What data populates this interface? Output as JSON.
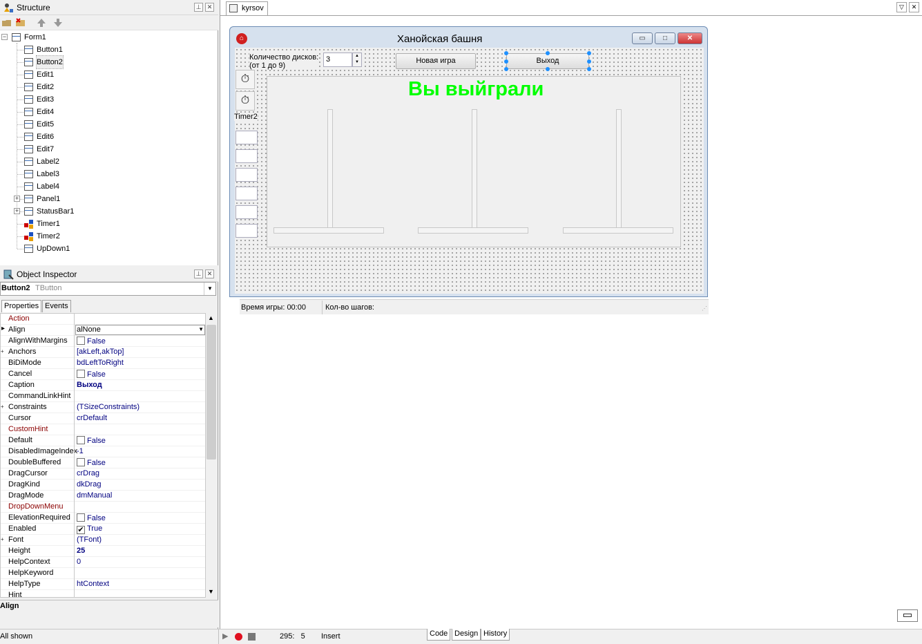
{
  "structure": {
    "title": "Structure",
    "root": "Form1",
    "items": [
      {
        "label": "Button1",
        "kind": "control"
      },
      {
        "label": "Button2",
        "kind": "control"
      },
      {
        "label": "Edit1",
        "kind": "control"
      },
      {
        "label": "Edit2",
        "kind": "control"
      },
      {
        "label": "Edit3",
        "kind": "control"
      },
      {
        "label": "Edit4",
        "kind": "control"
      },
      {
        "label": "Edit5",
        "kind": "control"
      },
      {
        "label": "Edit6",
        "kind": "control"
      },
      {
        "label": "Edit7",
        "kind": "control"
      },
      {
        "label": "Label2",
        "kind": "control"
      },
      {
        "label": "Label3",
        "kind": "control"
      },
      {
        "label": "Label4",
        "kind": "control"
      },
      {
        "label": "Panel1",
        "kind": "control",
        "expandable": true
      },
      {
        "label": "StatusBar1",
        "kind": "control",
        "expandable": true
      },
      {
        "label": "Timer1",
        "kind": "timer"
      },
      {
        "label": "Timer2",
        "kind": "timer"
      },
      {
        "label": "UpDown1",
        "kind": "control"
      }
    ]
  },
  "inspector": {
    "title": "Object Inspector",
    "selected_name": "Button2",
    "selected_type": "TButton",
    "tabs": [
      "Properties",
      "Events"
    ],
    "properties": [
      {
        "name": "Action",
        "value": "",
        "red": true
      },
      {
        "name": "Align",
        "value": "alNone",
        "selected": true
      },
      {
        "name": "AlignWithMargins",
        "value": "False",
        "check": "off"
      },
      {
        "name": "Anchors",
        "value": "[akLeft,akTop]",
        "plus": true
      },
      {
        "name": "BiDiMode",
        "value": "bdLeftToRight"
      },
      {
        "name": "Cancel",
        "value": "False",
        "check": "off"
      },
      {
        "name": "Caption",
        "value": "Выход",
        "bold": true
      },
      {
        "name": "CommandLinkHint",
        "value": ""
      },
      {
        "name": "Constraints",
        "value": "(TSizeConstraints)",
        "plus": true
      },
      {
        "name": "Cursor",
        "value": "crDefault"
      },
      {
        "name": "CustomHint",
        "value": "",
        "red": true
      },
      {
        "name": "Default",
        "value": "False",
        "check": "off"
      },
      {
        "name": "DisabledImageIndex",
        "value": "-1"
      },
      {
        "name": "DoubleBuffered",
        "value": "False",
        "check": "off"
      },
      {
        "name": "DragCursor",
        "value": "crDrag"
      },
      {
        "name": "DragKind",
        "value": "dkDrag"
      },
      {
        "name": "DragMode",
        "value": "dmManual"
      },
      {
        "name": "DropDownMenu",
        "value": "",
        "red": true
      },
      {
        "name": "ElevationRequired",
        "value": "False",
        "check": "off"
      },
      {
        "name": "Enabled",
        "value": "True",
        "check": "on"
      },
      {
        "name": "Font",
        "value": "(TFont)",
        "plus": true
      },
      {
        "name": "Height",
        "value": "25",
        "bold": true
      },
      {
        "name": "HelpContext",
        "value": "0"
      },
      {
        "name": "HelpKeyword",
        "value": ""
      },
      {
        "name": "HelpType",
        "value": "htContext"
      },
      {
        "name": "Hint",
        "value": ""
      }
    ],
    "description_title": "Align",
    "footer": "All shown"
  },
  "editor": {
    "tab_label": "kyrsov",
    "bottom_tabs": [
      "Code",
      "Design",
      "History"
    ],
    "position": "295:   5",
    "mode": "Insert"
  },
  "form": {
    "title": "Ханойская башня",
    "disk_label_line1": "Количество дисков:",
    "disk_label_line2": "(от 1 до 9)",
    "disk_count": "3",
    "new_game_label": "Новая игра",
    "exit_label": "Выход",
    "win_text": "Вы выйграли",
    "win_color": "#00ff00",
    "timer_label": "Timer2",
    "status_time": "Время игры: 00:00",
    "status_steps": "Кол-во шагов:"
  }
}
